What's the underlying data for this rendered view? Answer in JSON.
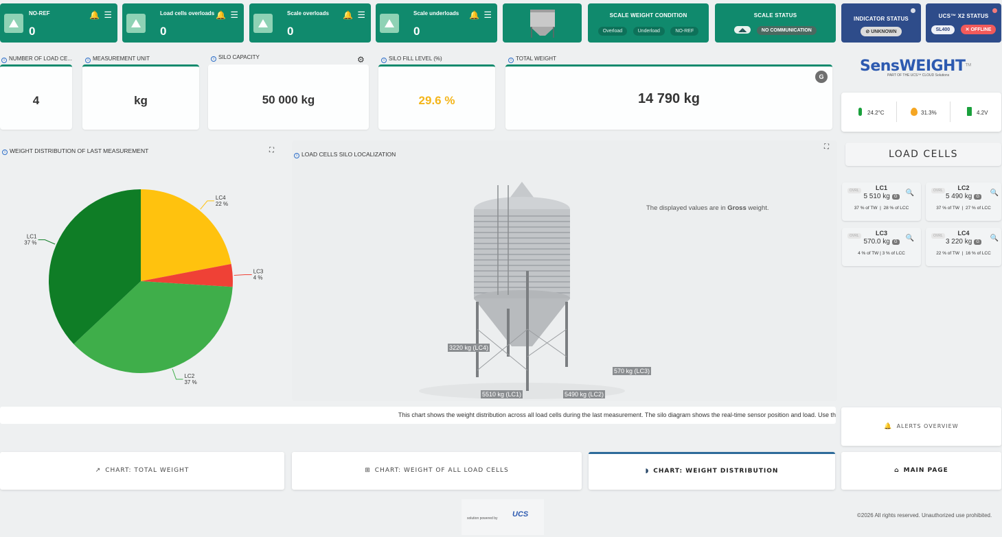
{
  "alarms": [
    {
      "title": "NO-REF",
      "count": "0"
    },
    {
      "title": "Load cells overloads",
      "count": "0"
    },
    {
      "title": "Scale overloads",
      "count": "0"
    },
    {
      "title": "Scale underloads",
      "count": "0"
    }
  ],
  "scale_weight_condition": {
    "title": "SCALE WEIGHT CONDITION",
    "pills": [
      "Overload",
      "Underload",
      "NO-REF"
    ]
  },
  "scale_status": {
    "title": "SCALE STATUS",
    "value": "NO COMMUNICATION"
  },
  "indicator_status": {
    "title": "INDICATOR STATUS",
    "value": "UNKNOWN"
  },
  "x2_status": {
    "title": "UCS™ X2 STATUS",
    "model": "SL400",
    "value": "OFFLINE"
  },
  "kpis": {
    "load_cells": {
      "label": "NUMBER OF LOAD CE...",
      "value": "4"
    },
    "unit": {
      "label": "MEASUREMENT UNIT",
      "value": "kg"
    },
    "capacity": {
      "label": "SILO CAPACITY",
      "value": "50 000 kg"
    },
    "fill": {
      "label": "SILO FILL LEVEL (%)",
      "value": "29.6 %"
    },
    "total": {
      "label": "TOTAL WEIGHT",
      "value": "14 790 kg",
      "badge": "G"
    }
  },
  "brand": {
    "name": "SensWEIGHT",
    "tm": "TM",
    "tagline": "PART OF THE UCS™ CLOUD Solutions"
  },
  "sensors": {
    "temperature": "24.2°C",
    "humidity": "31.3%",
    "battery": "4.2V"
  },
  "pie": {
    "title": "WEIGHT DISTRIBUTION OF LAST MEASUREMENT"
  },
  "chart_data": {
    "type": "pie",
    "categories": [
      "LC1",
      "LC2",
      "LC3",
      "LC4"
    ],
    "values": [
      37,
      37,
      4,
      22
    ],
    "labels": [
      "37 %",
      "37 %",
      "4 %",
      "22 %"
    ],
    "colors": [
      "#0f7d26",
      "#3fae4a",
      "#ef4136",
      "#ffc20e"
    ]
  },
  "localization": {
    "title": "LOAD CELLS SILO LOCALIZATION",
    "note_pre": "The displayed values are in ",
    "note_bold": "Gross",
    "note_post": " weight.",
    "tags": {
      "lc4": "3220 kg (LC4)",
      "lc3": "570 kg (LC3)",
      "lc1": "5510 kg (LC1)",
      "lc2": "5490 kg (LC2)"
    }
  },
  "load_cells_header": "LOAD CELLS",
  "load_cells": [
    {
      "name": "LC1",
      "ovrl": "OVRL",
      "kg": "5 510 kg",
      "g": "G",
      "a": "37 % of TW",
      "b": "28 % of LCC"
    },
    {
      "name": "LC2",
      "ovrl": "OVRL",
      "kg": "5 490 kg",
      "g": "G",
      "a": "37 % of TW",
      "b": "27 % of LCC"
    },
    {
      "name": "LC3",
      "ovrl": "OVRL",
      "kg": "570.0 kg",
      "g": "G",
      "a": "4 % of TW",
      "b": "3 % of LCC"
    },
    {
      "name": "LC4",
      "ovrl": "OVRL",
      "kg": "3 220 kg",
      "g": "G",
      "a": "22 % of TW",
      "b": "16 % of LCC"
    }
  ],
  "ticker": "This chart shows the weight distribution across all load cells during the last measurement. The silo diagram shows the real-time sensor position and load. Use th",
  "alerts_overview": "ALERTS OVERVIEW",
  "nav": {
    "total_weight": "CHART: TOTAL WEIGHT",
    "all_cells": "CHART: WEIGHT OF ALL LOAD CELLS",
    "distribution": "CHART: WEIGHT DISTRIBUTION",
    "main": "MAIN PAGE"
  },
  "footer": {
    "powered": "solution powered by",
    "copyright": "©2026  All rights reserved. Unauthorized use prohibited."
  }
}
